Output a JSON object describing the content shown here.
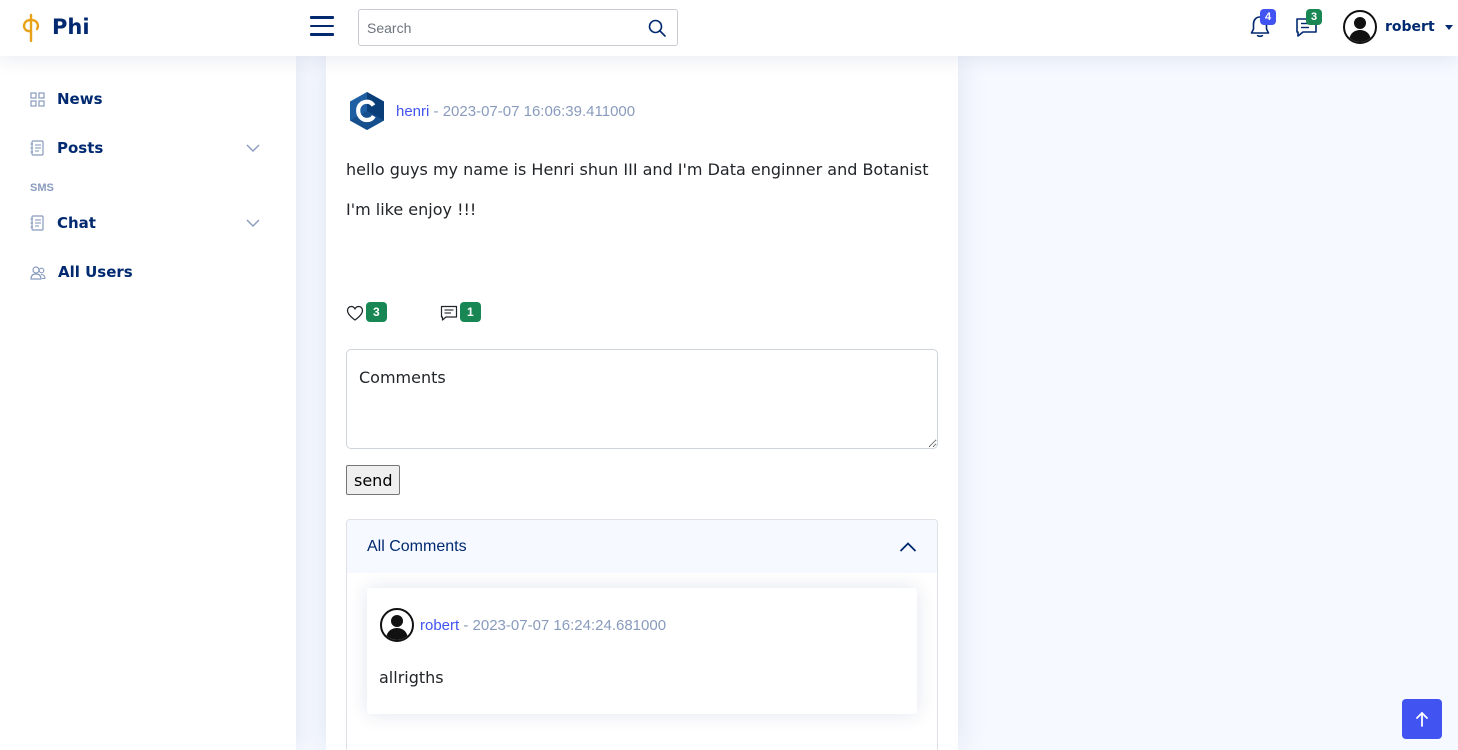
{
  "brand": {
    "name": "Phi",
    "accent": "#4154f1",
    "navy": "#012970",
    "logo_color": "#e8a21a"
  },
  "header": {
    "search_placeholder": "Search",
    "notifications_count": "4",
    "messages_count": "3",
    "user_name": "robert"
  },
  "sidebar": {
    "items": [
      {
        "label": "News",
        "icon": "grid-icon"
      },
      {
        "label": "Posts",
        "icon": "journal-icon",
        "expandable": true
      },
      {
        "label": "Chat",
        "icon": "journal-icon",
        "expandable": true
      },
      {
        "label": "All Users",
        "icon": "people-icon"
      }
    ],
    "section_heading": "SMS"
  },
  "post": {
    "author": "henri",
    "separator": " - ",
    "timestamp": "2023-07-07 16:06:39.411000",
    "paragraphs": [
      "hello guys my name is Henri shun III and I'm Data enginner and Botanist",
      "I'm like enjoy !!!"
    ],
    "likes_count": "3",
    "comments_count": "1"
  },
  "comment_form": {
    "placeholder": "Comments",
    "send_label": "send"
  },
  "comments": {
    "title": "All Comments",
    "items": [
      {
        "author": "robert",
        "timestamp": "2023-07-07 16:24:24.681000",
        "text": "allrigths"
      }
    ]
  }
}
